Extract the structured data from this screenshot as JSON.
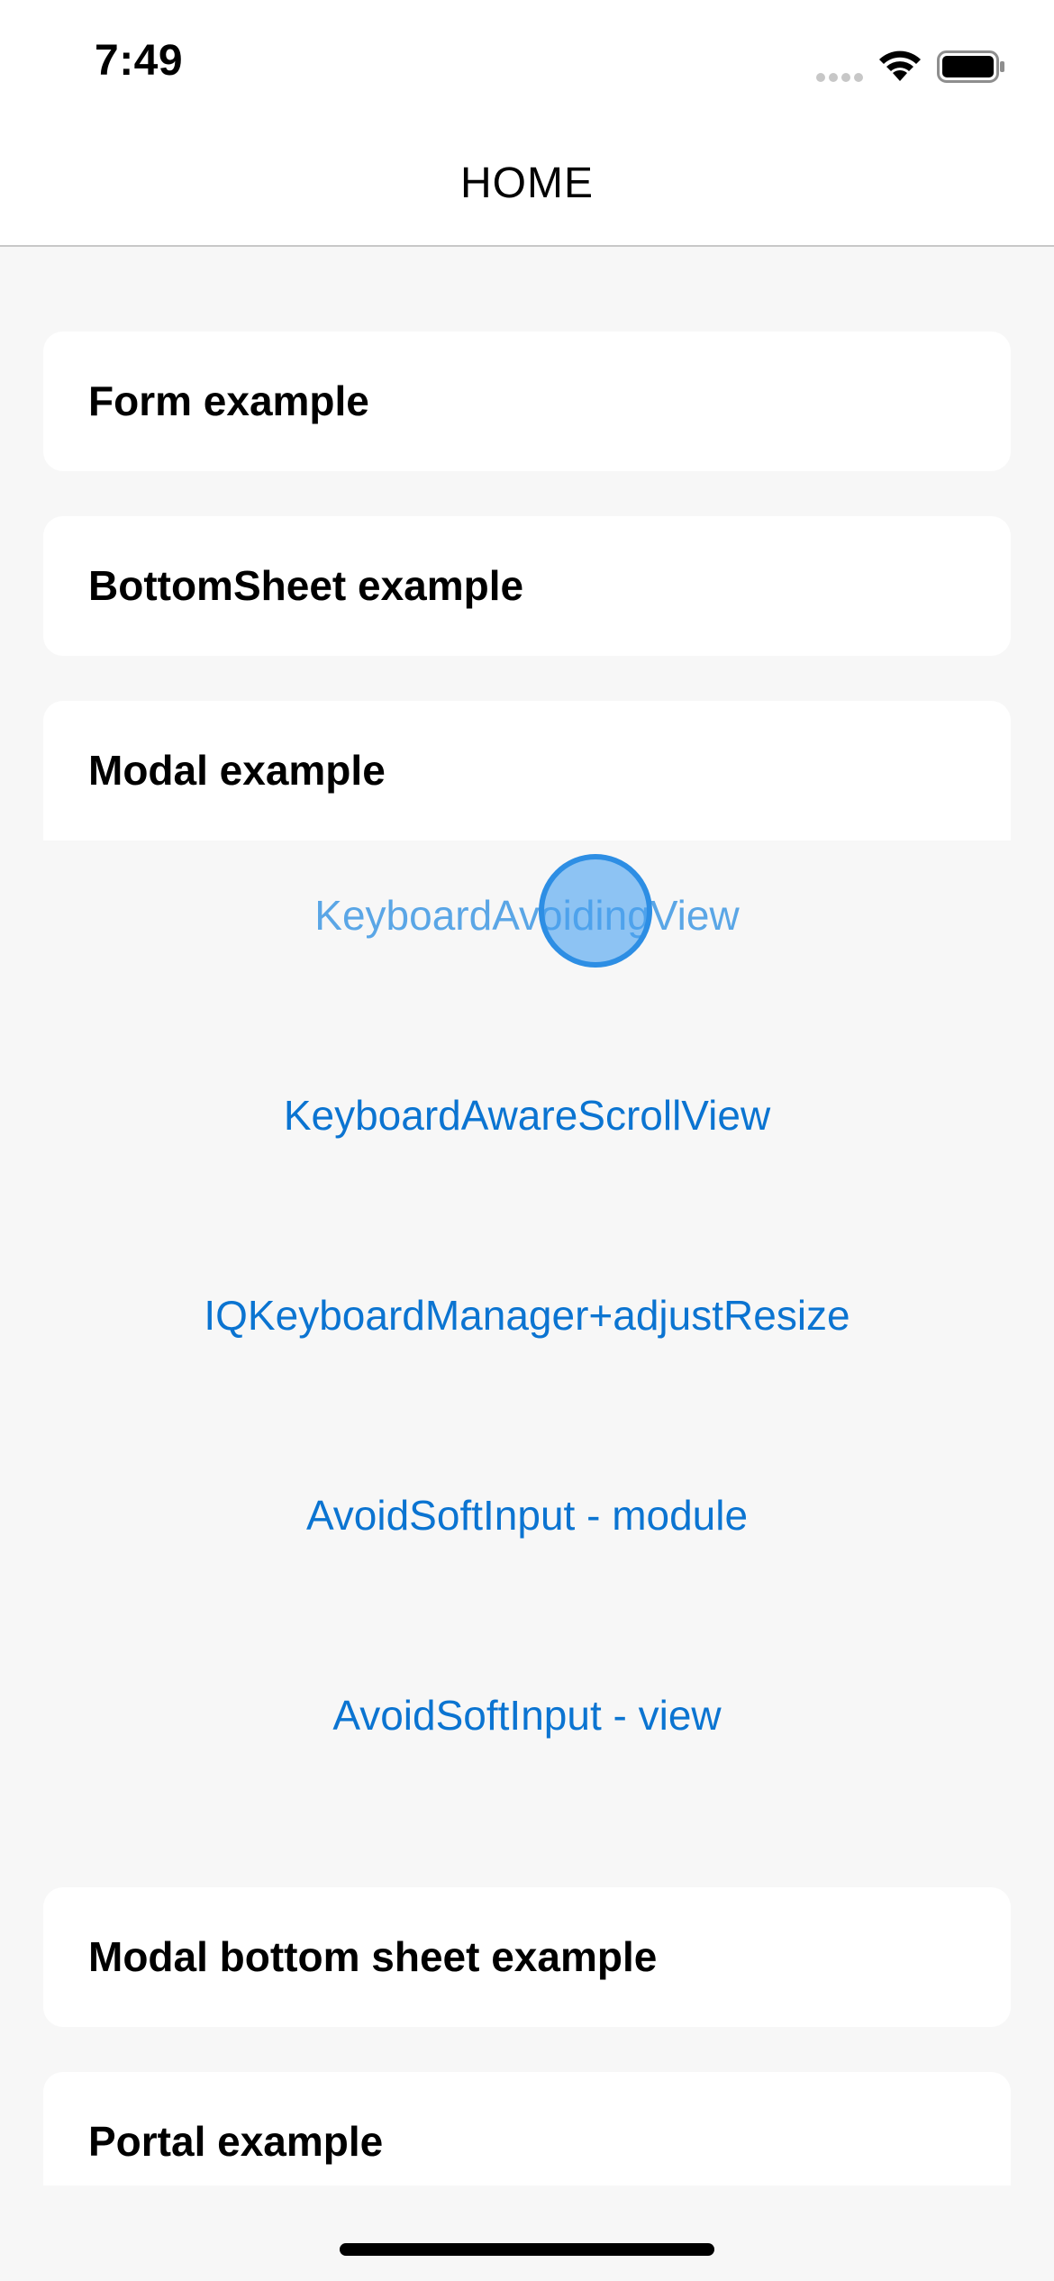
{
  "status_bar": {
    "time": "7:49"
  },
  "nav": {
    "title": "HOME"
  },
  "cards": {
    "form": "Form example",
    "bottom_sheet": "BottomSheet example",
    "modal": "Modal example",
    "modal_bottom_sheet": "Modal bottom sheet example",
    "portal": "Portal example"
  },
  "modal_options": [
    "KeyboardAvoidingView",
    "KeyboardAwareScrollView",
    "IQKeyboardManager+adjustResize",
    "AvoidSoftInput - module",
    "AvoidSoftInput - view"
  ],
  "colors": {
    "background": "#f7f7f7",
    "card": "#ffffff",
    "link": "#0b74d1",
    "link_pressed": "#5aa6e6",
    "touch": "#2d8ee4"
  },
  "icons": {
    "signal": "cellular-signal-icon",
    "wifi": "wifi-icon",
    "battery": "battery-icon"
  }
}
